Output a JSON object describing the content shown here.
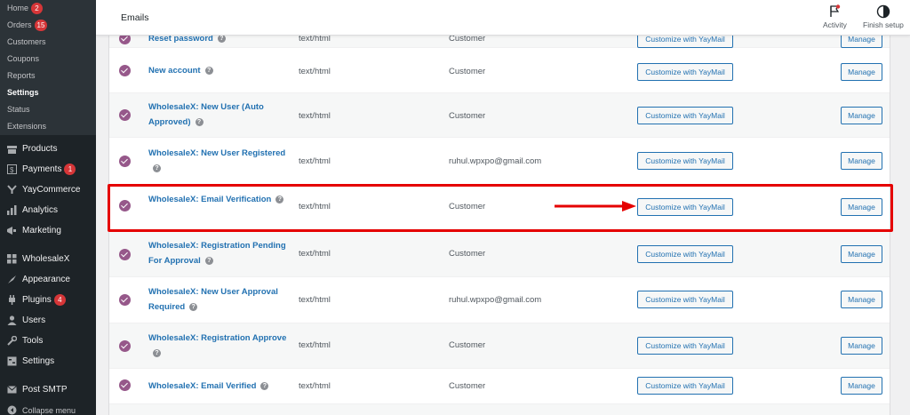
{
  "sidebar": {
    "submenu": [
      {
        "label": "Home",
        "badge": "2"
      },
      {
        "label": "Orders",
        "badge": "15"
      },
      {
        "label": "Customers",
        "badge": ""
      },
      {
        "label": "Coupons",
        "badge": ""
      },
      {
        "label": "Reports",
        "badge": ""
      },
      {
        "label": "Settings",
        "badge": "",
        "current": true
      },
      {
        "label": "Status",
        "badge": ""
      },
      {
        "label": "Extensions",
        "badge": ""
      }
    ],
    "menu": [
      {
        "label": "Products",
        "icon": "products-icon",
        "badge": ""
      },
      {
        "label": "Payments",
        "icon": "payments-icon",
        "badge": "1"
      },
      {
        "label": "YayCommerce",
        "icon": "yaycommerce-icon",
        "badge": ""
      },
      {
        "label": "Analytics",
        "icon": "analytics-icon",
        "badge": ""
      },
      {
        "label": "Marketing",
        "icon": "marketing-icon",
        "badge": ""
      },
      {
        "label": "WholesaleX",
        "icon": "wholesalex-icon",
        "badge": ""
      },
      {
        "label": "Appearance",
        "icon": "appearance-icon",
        "badge": ""
      },
      {
        "label": "Plugins",
        "icon": "plugins-icon",
        "badge": "4"
      },
      {
        "label": "Users",
        "icon": "users-icon",
        "badge": ""
      },
      {
        "label": "Tools",
        "icon": "tools-icon",
        "badge": ""
      },
      {
        "label": "Settings",
        "icon": "settings-icon",
        "badge": ""
      },
      {
        "label": "Post SMTP",
        "icon": "mail-icon",
        "badge": ""
      },
      {
        "label": "Collapse menu",
        "icon": "collapse-icon",
        "badge": ""
      }
    ]
  },
  "header": {
    "title": "Emails",
    "activity_label": "Activity",
    "finish_setup_label": "Finish setup"
  },
  "colors": {
    "accent": "#2271b1",
    "check": "#96588a",
    "highlight": "#e50000",
    "sidebar_bg": "#1d2327"
  },
  "emails": [
    {
      "name": "Reset password",
      "content_type": "text/html",
      "recipient": "Customer",
      "customize_label": "Customize with YayMail",
      "manage_label": "Manage"
    },
    {
      "name": "New account",
      "content_type": "text/html",
      "recipient": "Customer",
      "customize_label": "Customize with YayMail",
      "manage_label": "Manage"
    },
    {
      "name": "WholesaleX: New User (Auto Approved)",
      "content_type": "text/html",
      "recipient": "Customer",
      "customize_label": "Customize with YayMail",
      "manage_label": "Manage"
    },
    {
      "name": "WholesaleX: New User Registered",
      "content_type": "text/html",
      "recipient": "ruhul.wpxpo@gmail.com",
      "customize_label": "Customize with YayMail",
      "manage_label": "Manage"
    },
    {
      "name": "WholesaleX: Email Verification",
      "content_type": "text/html",
      "recipient": "Customer",
      "customize_label": "Customize with YayMail",
      "manage_label": "Manage"
    },
    {
      "name": "WholesaleX: Registration Pending For Approval",
      "content_type": "text/html",
      "recipient": "Customer",
      "customize_label": "Customize with YayMail",
      "manage_label": "Manage"
    },
    {
      "name": "WholesaleX: New User Approval Required",
      "content_type": "text/html",
      "recipient": "ruhul.wpxpo@gmail.com",
      "customize_label": "Customize with YayMail",
      "manage_label": "Manage"
    },
    {
      "name": "WholesaleX: Registration Approve",
      "content_type": "text/html",
      "recipient": "Customer",
      "customize_label": "Customize with YayMail",
      "manage_label": "Manage"
    },
    {
      "name": "WholesaleX: Email Verified",
      "content_type": "text/html",
      "recipient": "Customer",
      "customize_label": "Customize with YayMail",
      "manage_label": "Manage"
    }
  ]
}
